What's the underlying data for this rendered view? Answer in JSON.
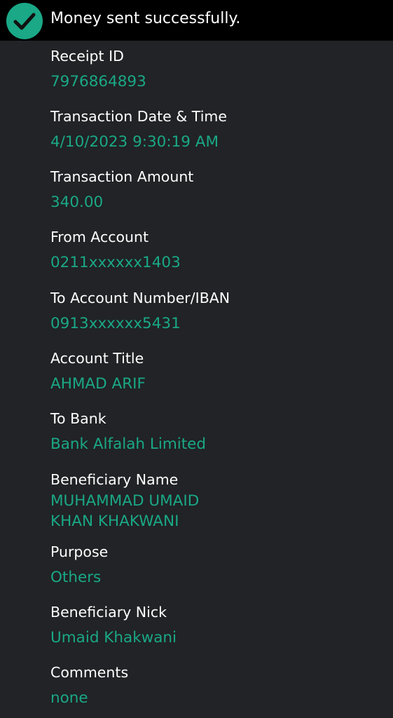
{
  "banner": {
    "icon": "check-circle-icon",
    "message": "Money sent successfully."
  },
  "colors": {
    "accent": "#1aa886",
    "background": "#212326",
    "banner": "#000000",
    "label": "#ffffff"
  },
  "fields": {
    "receipt_id": {
      "label": "Receipt ID",
      "value": "7976864893"
    },
    "date_time": {
      "label": "Transaction Date & Time",
      "value": "4/10/2023 9:30:19 AM"
    },
    "amount": {
      "label": "Transaction Amount",
      "value": "340.00"
    },
    "from_account": {
      "label": "From Account",
      "value": "0211xxxxxx1403"
    },
    "to_account": {
      "label": "To Account Number/IBAN",
      "value": "0913xxxxxx5431"
    },
    "account_title": {
      "label": "Account Title",
      "value": "AHMAD ARIF"
    },
    "to_bank": {
      "label": "To Bank",
      "value": "Bank Alfalah Limited"
    },
    "beneficiary_name": {
      "label": "Beneficiary Name",
      "value": "MUHAMMAD UMAID KHAN KHAKWANI"
    },
    "purpose": {
      "label": "Purpose",
      "value": "Others"
    },
    "beneficiary_nick": {
      "label": "Beneficiary Nick",
      "value": "Umaid Khakwani"
    },
    "comments": {
      "label": "Comments",
      "value": "none"
    }
  }
}
